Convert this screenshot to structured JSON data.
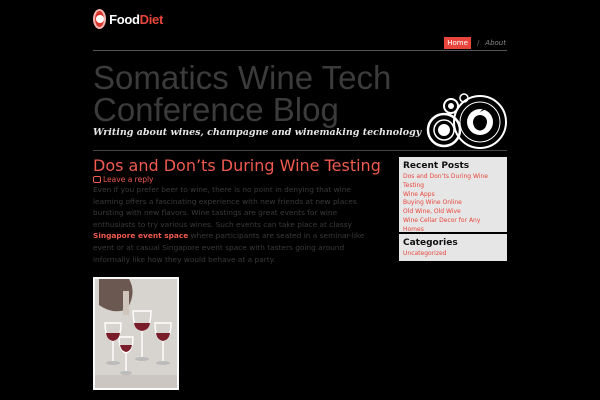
{
  "brand": {
    "prefix": "Food",
    "suffix": "Diet"
  },
  "nav": {
    "home": "Home",
    "about": "About"
  },
  "site": {
    "title": "Somatics Wine Tech Conference Blog",
    "tagline": "Writing about wines, champagne and winemaking technology"
  },
  "post": {
    "title": "Dos and Don’ts During Wine Testing",
    "reply_label": "Leave a reply",
    "body_before_link": "Even if you prefer beer to wine, there is no point in denying that wine learning offers a fascinating experience with new friends at new places bursting with new flavors. Wine tastings are great events for wine enthusiasts to try various wines. Such events can take place at classy ",
    "link_text": "Singapore event space",
    "body_after_link": " where participants are seated in a seminar-like event or at casual Singapore event space with tasters going around informally like how they would behave at a party."
  },
  "sidebar": {
    "recent_title": "Recent Posts",
    "recent_posts": [
      "Dos and Don’ts During Wine Testing",
      "Wine Apps",
      "Buying Wine Online",
      "Old Wine, Old Wive",
      "Wine Cellar Decor for Any Homes"
    ],
    "categories_title": "Categories",
    "categories": [
      "Uncategorized"
    ]
  },
  "colors": {
    "accent": "#e8453c",
    "background": "#000000",
    "widget_bg": "#e6e6e6"
  }
}
